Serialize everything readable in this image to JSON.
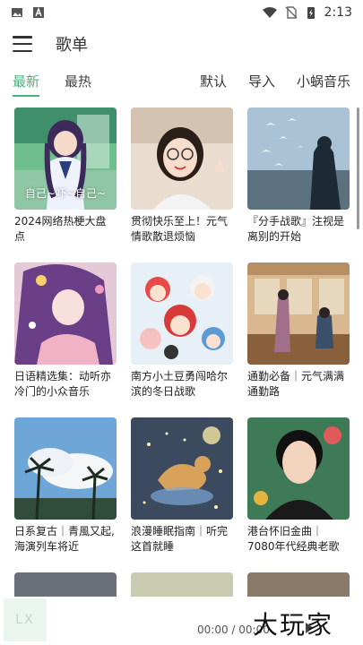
{
  "status": {
    "time": "2:13"
  },
  "appbar": {
    "title": "歌单"
  },
  "tabs": {
    "left": [
      {
        "label": "最新",
        "active": true
      },
      {
        "label": "最热",
        "active": false
      }
    ],
    "right": [
      "默认",
      "导入",
      "小蜗音乐"
    ]
  },
  "playlists": [
    {
      "title": "2024网络热梗大盘点",
      "cover_text": "自己~吓~自己~"
    },
    {
      "title": "贯彻快乐至上！元气情歌散退烦恼",
      "cover_text": ""
    },
    {
      "title": "『分手战歌』注视是离别的开始",
      "cover_text": ""
    },
    {
      "title": "日语精选集：动听亦冷门的小众音乐",
      "cover_text": ""
    },
    {
      "title": "南方小土豆勇闯哈尔滨的冬日战歌",
      "cover_text": ""
    },
    {
      "title": "通勤必备｜元气满满通勤路",
      "cover_text": ""
    },
    {
      "title": "日系复古｜青風又起,海演列车将近",
      "cover_text": ""
    },
    {
      "title": "浪漫睡眠指南｜听完这首就睡",
      "cover_text": ""
    },
    {
      "title": "港台怀旧金曲｜7080年代经典老歌",
      "cover_text": ""
    }
  ],
  "player": {
    "logo": "LX",
    "time": "00:00 / 00:00"
  },
  "watermark": "大玩家",
  "colors": {
    "accent": "#4caf7d"
  }
}
